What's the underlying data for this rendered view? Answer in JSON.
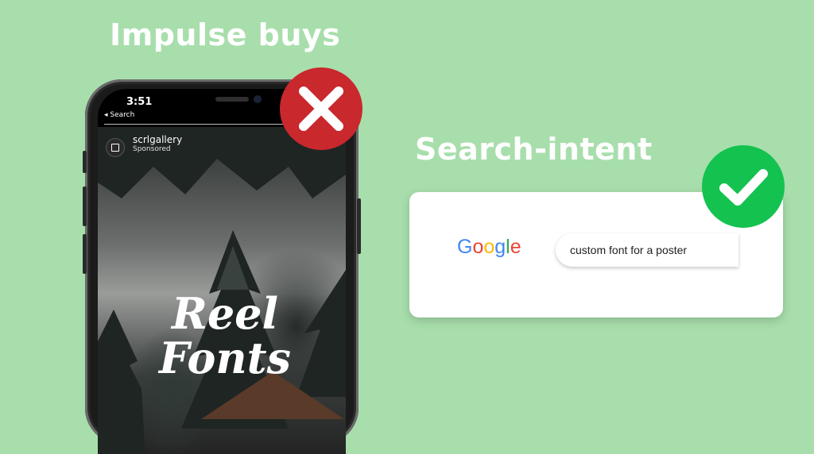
{
  "left": {
    "heading": "Impulse buys"
  },
  "right": {
    "heading": "Search-intent"
  },
  "phone": {
    "time": "3:51",
    "back_label": "◂ Search",
    "account_name": "scrlgallery",
    "account_subtitle": "Sponsored",
    "logo_line1": "Reel",
    "logo_line2": "Fonts"
  },
  "search": {
    "google_letters": [
      "G",
      "o",
      "o",
      "g",
      "l",
      "e"
    ],
    "google_colors": [
      "#4285F4",
      "#EA4335",
      "#FBBC05",
      "#4285F4",
      "#34A853",
      "#EA4335"
    ],
    "query": "custom font for a poster"
  },
  "icons": {
    "wrong": "x-mark-icon",
    "right": "checkmark-icon"
  },
  "colors": {
    "background": "#a8deac",
    "wrong": "#c9282d",
    "right": "#14c24f"
  }
}
